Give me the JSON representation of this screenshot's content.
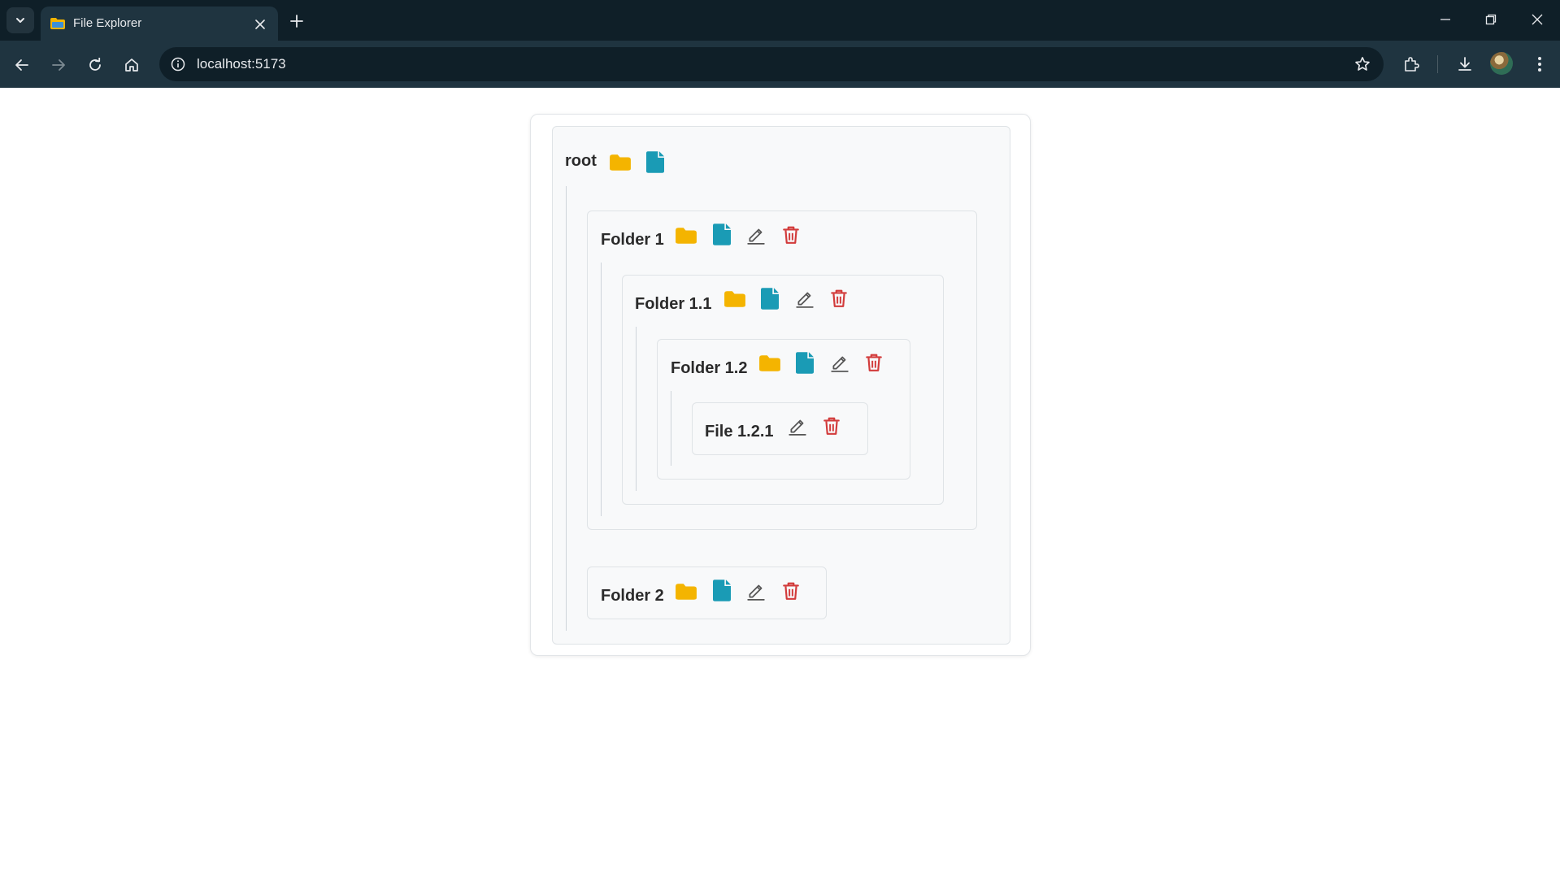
{
  "browser": {
    "tab_title": "File Explorer",
    "url": "localhost:5173"
  },
  "explorer": {
    "root_label": "root",
    "folder_1": "Folder 1",
    "folder_1_1": "Folder 1.1",
    "folder_1_2": "Folder 1.2",
    "file_1_2_1": "File 1.2.1",
    "folder_2": "Folder 2"
  },
  "icons": {
    "add_folder": "folder-icon",
    "add_file": "file-icon",
    "edit": "pencil-icon",
    "delete": "trash-icon"
  },
  "colors": {
    "folder": "#f4b400",
    "file": "#1a9bb5",
    "edit": "#555555",
    "delete": "#d23b3b",
    "chrome_dark": "#0f1f28",
    "chrome_bar": "#1f3440"
  }
}
